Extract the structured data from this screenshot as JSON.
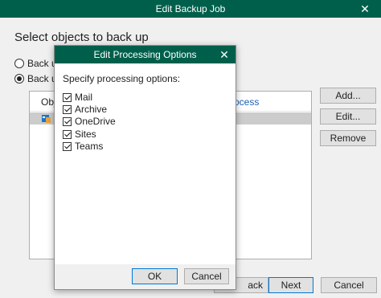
{
  "window": {
    "title": "Edit Backup Job",
    "close_glyph": "✕"
  },
  "main": {
    "heading": "Select objects to back up",
    "radio1": "Back up",
    "radio2": "Back up",
    "col_objects": "Obje",
    "col_processing": "ocess",
    "row_processing": "l",
    "buttons": {
      "add": "Add...",
      "edit": "Edit...",
      "remove": "Remove"
    }
  },
  "footer": {
    "back": "ack",
    "next": "Next",
    "cancel": "Cancel"
  },
  "dialog": {
    "title": "Edit Processing Options",
    "close_glyph": "✕",
    "label": "Specify processing options:",
    "options": [
      {
        "label": "Mail",
        "checked": true
      },
      {
        "label": "Archive",
        "checked": true
      },
      {
        "label": "OneDrive",
        "checked": true
      },
      {
        "label": "Sites",
        "checked": true
      },
      {
        "label": "Teams",
        "checked": true
      }
    ],
    "ok": "OK",
    "cancel": "Cancel"
  },
  "colors": {
    "titlebar": "#005f4b",
    "link": "#1a5fb4",
    "selected_row": "#cccccc"
  },
  "icons": {
    "org": "office365-organization-icon"
  }
}
